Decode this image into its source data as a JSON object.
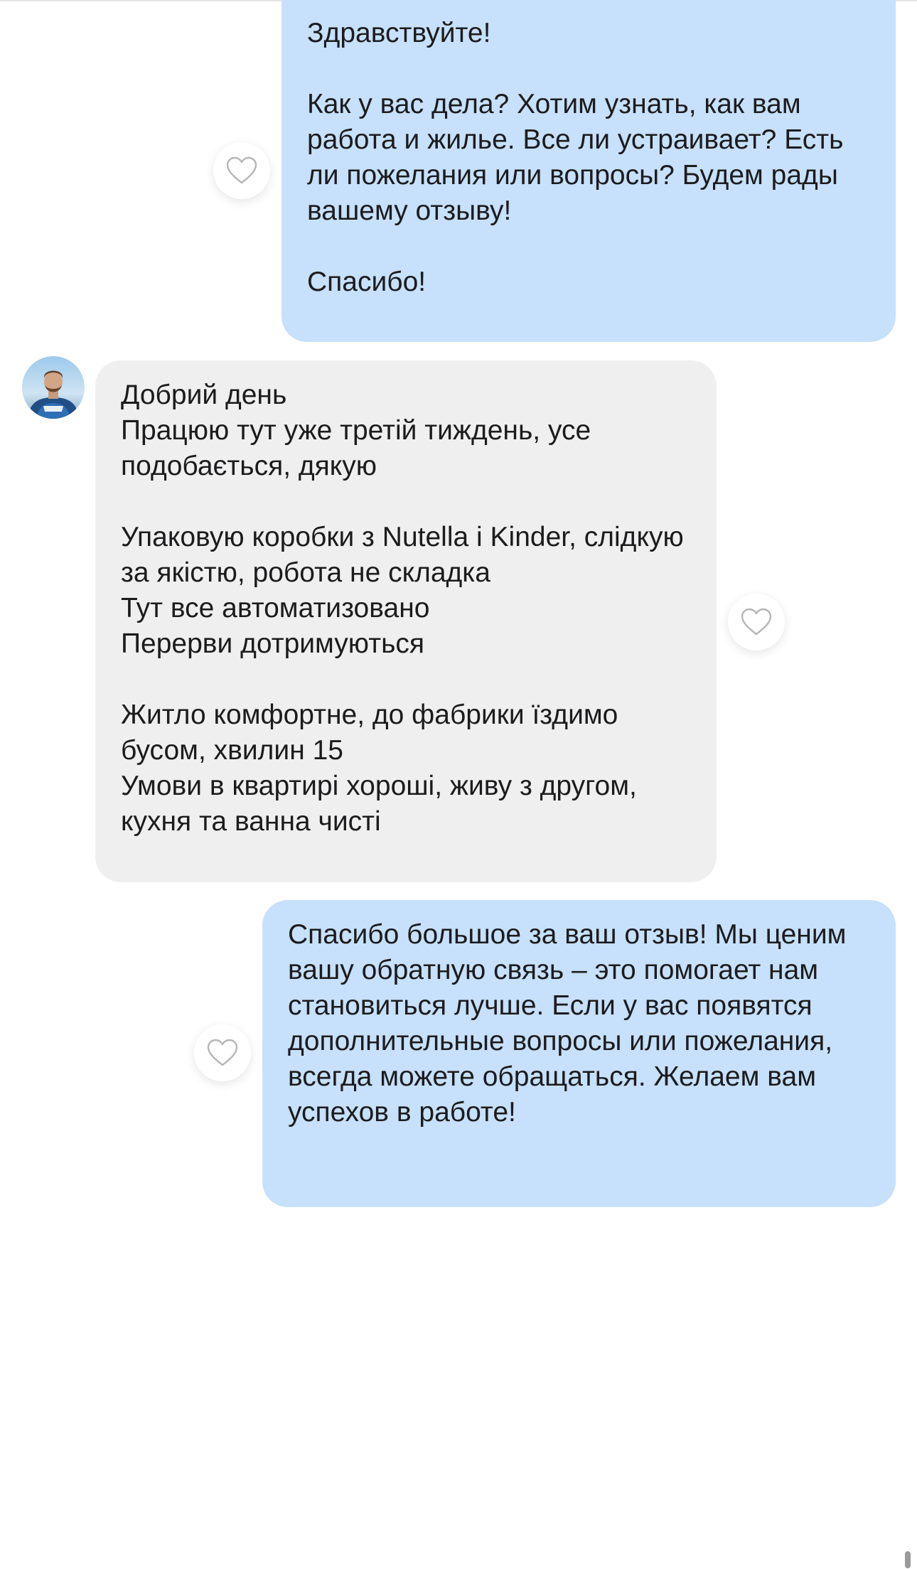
{
  "messages": [
    {
      "direction": "outgoing",
      "text": "Здравствуйте!\n\nКак у вас дела? Хотим узнать, как вам работа и жилье. Все ли устраивает? Есть ли пожелания или вопросы? Будем рады вашему отзыву!\n\nСпасибо!"
    },
    {
      "direction": "incoming",
      "text": "Добрий день\nПрацюю тут уже третій тиждень, усе подобається, дякую\n\nУпаковую коробки з Nutella і Kinder, слідкую за якістю, робота не складка\nТут все автоматизовано\nПерерви дотримуються\n\nЖитло комфортне, до фабрики їздимо бусом, хвилин 15\nУмови в квартирі хороші, живу з другом, кухня та ванна чисті"
    },
    {
      "direction": "outgoing",
      "text": "Спасибо большое за ваш отзыв! Мы ценим вашу обратную связь – это помогает нам становиться лучше. Если у вас появятся дополнительные вопросы или пожелания, всегда можете обращаться. Желаем вам успехов в работе!"
    }
  ],
  "icons": {
    "like": "heart-outline-icon",
    "avatar": "user-avatar-photo"
  },
  "colors": {
    "outgoing_bubble": "#c7e0fb",
    "incoming_bubble": "#efefef",
    "text": "#1c1c1e",
    "heart_stroke": "#b5b5b5"
  }
}
